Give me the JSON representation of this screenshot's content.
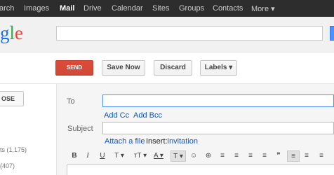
{
  "topbar": {
    "items": [
      "arch",
      "Images",
      "Mail",
      "Drive",
      "Calendar",
      "Sites",
      "Groups",
      "Contacts",
      "More ▾"
    ],
    "active_index": 2
  },
  "header": {
    "logo_text": [
      "g",
      "l",
      "e"
    ],
    "search_value": ""
  },
  "toolbar": {
    "send_label": "SEND",
    "save_label": "Save Now",
    "discard_label": "Discard",
    "labels_label": "Labels ▾"
  },
  "leftpanel": {
    "close_label": "OSE",
    "count1": "ts (1,175)",
    "count2": "(407)"
  },
  "compose": {
    "to_label": "To",
    "to_value": "",
    "add_cc": "Add Cc",
    "add_bcc": "Add Bcc",
    "subject_label": "Subject",
    "subject_value": "",
    "attach_file": "Attach a file",
    "insert_label": "Insert:",
    "invitation": "Invitation"
  },
  "format_bar": {
    "bold": "B",
    "italic": "I",
    "underline": "U",
    "font": "T ▾",
    "size": "ᴛT ▾",
    "text_color": "A ▾",
    "highlight": "T ▾",
    "emoji": "☺",
    "link": "⊕",
    "numbered": "≡",
    "bulleted": "≡",
    "indent_less": "≡",
    "indent_more": "≡",
    "quote": "❞",
    "align_left": "≡",
    "align_center": "≡",
    "align_right": "≡"
  },
  "colors": {
    "topbar_bg": "#2d2d2d",
    "send_bg": "#d14836",
    "link": "#1155cc"
  }
}
